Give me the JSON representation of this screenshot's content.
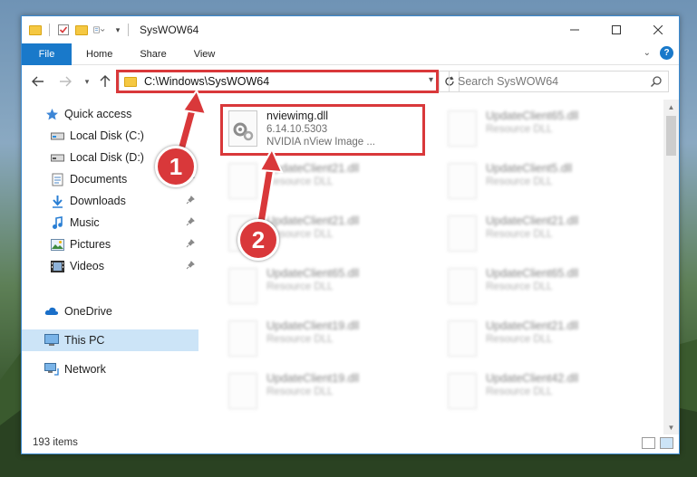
{
  "window": {
    "title": "SysWOW64"
  },
  "ribbon": {
    "tabs": [
      "File",
      "Home",
      "Share",
      "View"
    ]
  },
  "address": {
    "path": "C:\\Windows\\SysWOW64"
  },
  "search": {
    "placeholder": "Search SysWOW64"
  },
  "navpane": {
    "items": [
      {
        "label": "Quick access",
        "icon": "star-icon"
      },
      {
        "label": "Local Disk (C:)",
        "icon": "drive-icon"
      },
      {
        "label": "Local Disk (D:)",
        "icon": "drive-icon"
      },
      {
        "label": "Documents",
        "icon": "documents-icon"
      },
      {
        "label": "Downloads",
        "icon": "download-icon"
      },
      {
        "label": "Music",
        "icon": "music-icon"
      },
      {
        "label": "Pictures",
        "icon": "pictures-icon"
      },
      {
        "label": "Videos",
        "icon": "videos-icon"
      },
      {
        "label": "OneDrive",
        "icon": "cloud-icon"
      },
      {
        "label": "This PC",
        "icon": "computer-icon"
      },
      {
        "label": "Network",
        "icon": "network-icon"
      }
    ]
  },
  "files": {
    "highlighted": {
      "name": "nviewimg.dll",
      "version": "6.14.10.5303",
      "description": "NVIDIA nView Image ..."
    },
    "blurred": [
      {
        "name": "UpdateClient65.dll",
        "description": "Resource DLL"
      },
      {
        "name": "UpdateClient21.dll",
        "description": "Resource DLL"
      },
      {
        "name": "UpdateClient5.dll",
        "description": "Resource DLL"
      },
      {
        "name": "UpdateClient21.dll",
        "description": "Resource DLL"
      },
      {
        "name": "UpdateClient21.dll",
        "description": "Resource DLL"
      },
      {
        "name": "UpdateClient65.dll",
        "description": "Resource DLL"
      },
      {
        "name": "UpdateClient65.dll",
        "description": "Resource DLL"
      },
      {
        "name": "UpdateClient19.dll",
        "description": "Resource DLL"
      },
      {
        "name": "UpdateClient21.dll",
        "description": "Resource DLL"
      },
      {
        "name": "UpdateClient19.dll",
        "description": "Resource DLL"
      },
      {
        "name": "UpdateClient42.dll",
        "description": "Resource DLL"
      }
    ]
  },
  "status": {
    "item_count": "193 items"
  },
  "callouts": {
    "one": "1",
    "two": "2"
  },
  "colors": {
    "accent": "#1979ca",
    "highlight": "#d9383a",
    "selected": "#cce4f7"
  }
}
